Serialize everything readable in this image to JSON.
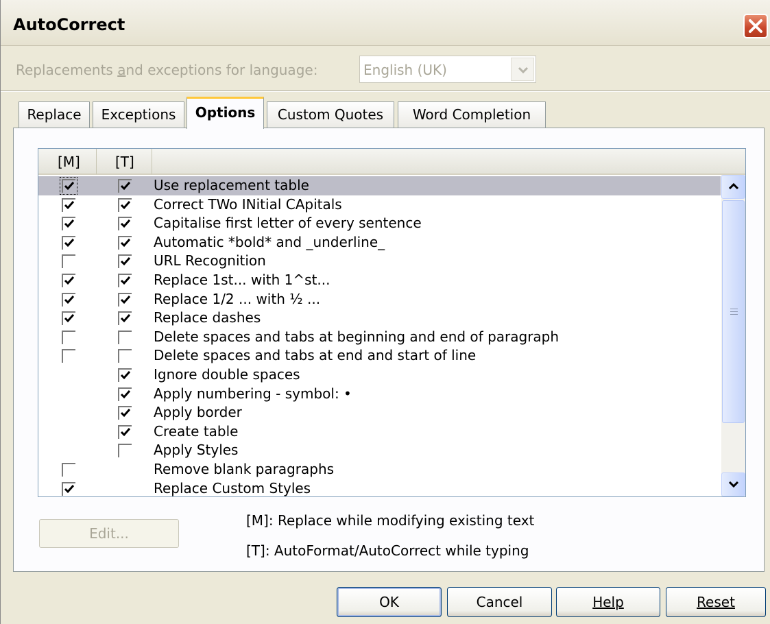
{
  "window": {
    "title": "AutoCorrect"
  },
  "language": {
    "label_pre": "Replacements ",
    "label_key": "a",
    "label_post": "nd exceptions for language:",
    "value": "English (UK)"
  },
  "tabs": [
    {
      "label": "Replace"
    },
    {
      "label": "Exceptions"
    },
    {
      "label": "Options",
      "active": true
    },
    {
      "label": "Custom Quotes"
    },
    {
      "label": "Word Completion"
    }
  ],
  "options": {
    "headers": [
      "[M]",
      "[T]",
      ""
    ],
    "rows": [
      {
        "label": "Use replacement table",
        "m": true,
        "t": true
      },
      {
        "label": "Correct TWo INitial CApitals",
        "m": true,
        "t": true
      },
      {
        "label": "Capitalise first letter of every sentence",
        "m": true,
        "t": true
      },
      {
        "label": "Automatic *bold* and _underline_",
        "m": true,
        "t": true
      },
      {
        "label": "URL Recognition",
        "m": false,
        "t": true
      },
      {
        "label": "Replace 1st... with 1^st...",
        "m": true,
        "t": true
      },
      {
        "label": "Replace 1/2 ... with ½ ...",
        "m": true,
        "t": true
      },
      {
        "label": "Replace dashes",
        "m": true,
        "t": true
      },
      {
        "label": "Delete spaces and tabs at beginning and end of paragraph",
        "m": false,
        "t": false
      },
      {
        "label": "Delete spaces and tabs at end and start of line",
        "m": false,
        "t": false
      },
      {
        "label": "Ignore double spaces",
        "m": null,
        "t": true
      },
      {
        "label": "Apply numbering - symbol: •",
        "m": null,
        "t": true
      },
      {
        "label": "Apply border",
        "m": null,
        "t": true
      },
      {
        "label": "Create table",
        "m": null,
        "t": true
      },
      {
        "label": "Apply Styles",
        "m": null,
        "t": false
      },
      {
        "label": "Remove blank paragraphs",
        "m": false,
        "t": null
      },
      {
        "label": "Replace Custom Styles",
        "m": true,
        "t": null
      }
    ]
  },
  "edit_button": {
    "label": "Edit...",
    "enabled": false
  },
  "legend": {
    "m": "[M]: Replace while modifying existing text",
    "t": "[T]: AutoFormat/AutoCorrect while typing"
  },
  "buttons": {
    "ok": "OK",
    "cancel": "Cancel",
    "help": "Help",
    "reset": "Reset"
  },
  "colors": {
    "selected_row": "#BDBDC8",
    "active_tab_accent": "#FFC83C",
    "close_button": "#C8462A"
  },
  "icons": {
    "close": "close-icon",
    "dropdown": "chevron-down-icon",
    "scroll_up": "arrow-up-icon",
    "scroll_down": "arrow-down-icon"
  }
}
